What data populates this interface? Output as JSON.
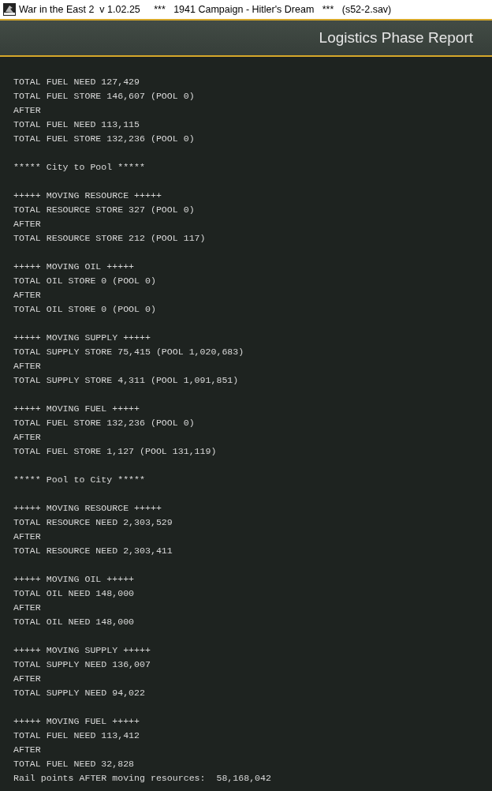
{
  "window": {
    "title": "War in the East 2  v 1.02.25     ***   1941 Campaign - Hitler's Dream   ***   (s52-2.sav)"
  },
  "header": {
    "title": "Logistics Phase Report"
  },
  "report_blocks": [
    [
      "TOTAL FUEL NEED 127,429",
      "TOTAL FUEL STORE 146,607 (POOL 0)",
      "AFTER",
      "TOTAL FUEL NEED 113,115",
      "TOTAL FUEL STORE 132,236 (POOL 0)"
    ],
    [
      "***** City to Pool *****"
    ],
    [
      "+++++ MOVING RESOURCE +++++",
      "TOTAL RESOURCE STORE 327 (POOL 0)",
      "AFTER",
      "TOTAL RESOURCE STORE 212 (POOL 117)"
    ],
    [
      "+++++ MOVING OIL +++++",
      "TOTAL OIL STORE 0 (POOL 0)",
      "AFTER",
      "TOTAL OIL STORE 0 (POOL 0)"
    ],
    [
      "+++++ MOVING SUPPLY +++++",
      "TOTAL SUPPLY STORE 75,415 (POOL 1,020,683)",
      "AFTER",
      "TOTAL SUPPLY STORE 4,311 (POOL 1,091,851)"
    ],
    [
      "+++++ MOVING FUEL +++++",
      "TOTAL FUEL STORE 132,236 (POOL 0)",
      "AFTER",
      "TOTAL FUEL STORE 1,127 (POOL 131,119)"
    ],
    [
      "***** Pool to City *****"
    ],
    [
      "+++++ MOVING RESOURCE +++++",
      "TOTAL RESOURCE NEED 2,303,529",
      "AFTER",
      "TOTAL RESOURCE NEED 2,303,411"
    ],
    [
      "+++++ MOVING OIL +++++",
      "TOTAL OIL NEED 148,000",
      "AFTER",
      "TOTAL OIL NEED 148,000"
    ],
    [
      "+++++ MOVING SUPPLY +++++",
      "TOTAL SUPPLY NEED 136,007",
      "AFTER",
      "TOTAL SUPPLY NEED 94,022"
    ],
    [
      "+++++ MOVING FUEL +++++",
      "TOTAL FUEL NEED 113,412",
      "AFTER",
      "TOTAL FUEL NEED 32,828",
      "Rail points AFTER moving resources:  58,168,042"
    ]
  ]
}
